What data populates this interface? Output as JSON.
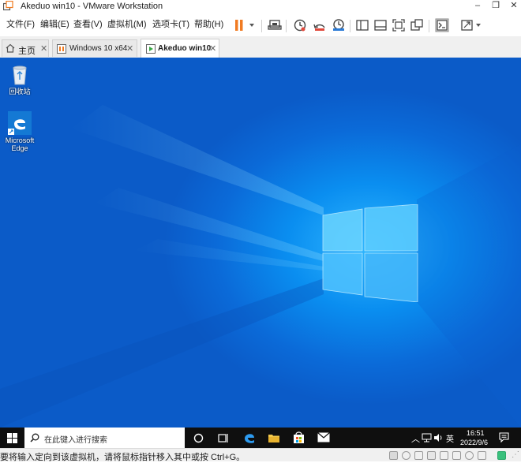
{
  "window": {
    "title": "Akeduo win10 - VMware Workstation",
    "minimize_glyph": "–",
    "restore_glyph": "❐",
    "close_glyph": "✕"
  },
  "menu": [
    "文件(F)",
    "编辑(E)",
    "查看(V)",
    "虚拟机(M)",
    "选项卡(T)",
    "帮助(H)"
  ],
  "colors": {
    "pause": "#f07b22",
    "desktop": "#0b7be0",
    "taskbar": "#0f0f0f"
  },
  "tabs": [
    {
      "label": "主页",
      "icon": "home-icon"
    },
    {
      "label": "Windows 10 x64",
      "icon": "vm-tab-icon"
    },
    {
      "label": "Akeduo win10",
      "icon": "vm-running-icon"
    }
  ],
  "desktop_icons": [
    {
      "label": "回收站",
      "icon": "recycle-bin-icon"
    },
    {
      "label": "Microsoft Edge",
      "label_line1": "Microsoft",
      "label_line2": "Edge",
      "icon": "edge-icon"
    }
  ],
  "taskbar": {
    "search_placeholder": "在此键入进行搜索",
    "language": "英",
    "time": "16:51",
    "date": "2022/9/6"
  },
  "status": {
    "text": "要将输入定向到该虚拟机，请将鼠标指针移入其中或按 Ctrl+G。"
  }
}
